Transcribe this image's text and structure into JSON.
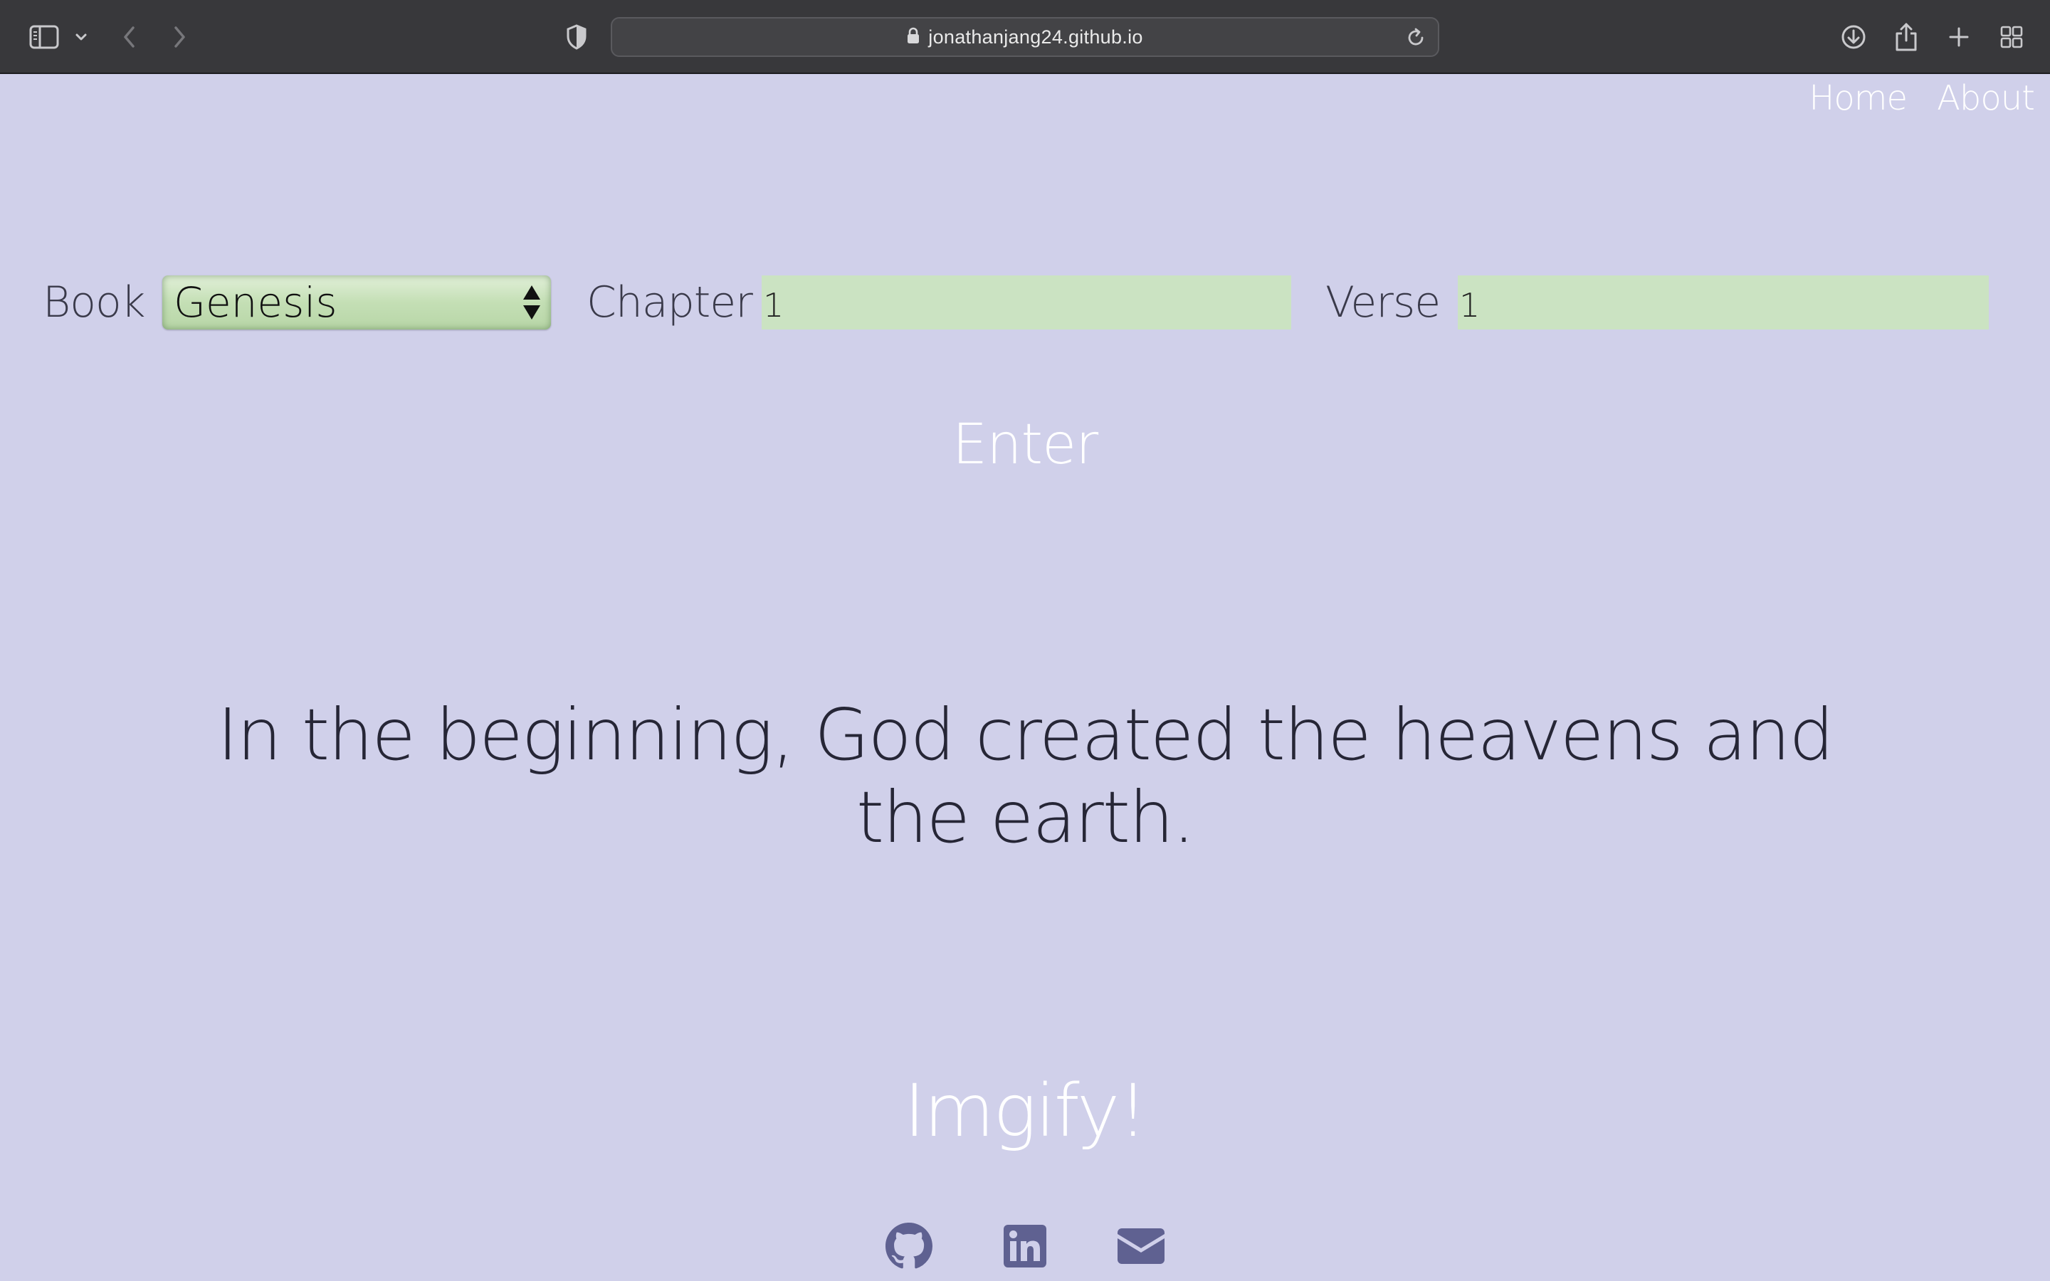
{
  "browser": {
    "url": "jonathanjang24.github.io",
    "icons": [
      "sidebar-icon",
      "chevron-down-icon",
      "back-icon",
      "forward-icon",
      "shield-icon",
      "lock-icon",
      "reload-icon",
      "download-icon",
      "share-icon",
      "new-tab-icon",
      "tab-overview-icon"
    ]
  },
  "nav": {
    "home": "Home",
    "about": "About"
  },
  "form": {
    "book_label": "Book",
    "book_value": "Genesis",
    "chapter_label": "Chapter",
    "chapter_value": "1",
    "verse_label": "Verse",
    "verse_value": "1"
  },
  "actions": {
    "enter": "Enter",
    "imgify": "Imgify!"
  },
  "verse_text": "In the beginning, God created the heavens and the earth.",
  "social": {
    "icons": [
      "github-icon",
      "linkedin-icon",
      "email-icon"
    ]
  },
  "colors": {
    "background": "#d0d0ea",
    "input_fill": "#cbe3c2",
    "chrome": "#38383b",
    "icon_color": "#5f6191"
  }
}
